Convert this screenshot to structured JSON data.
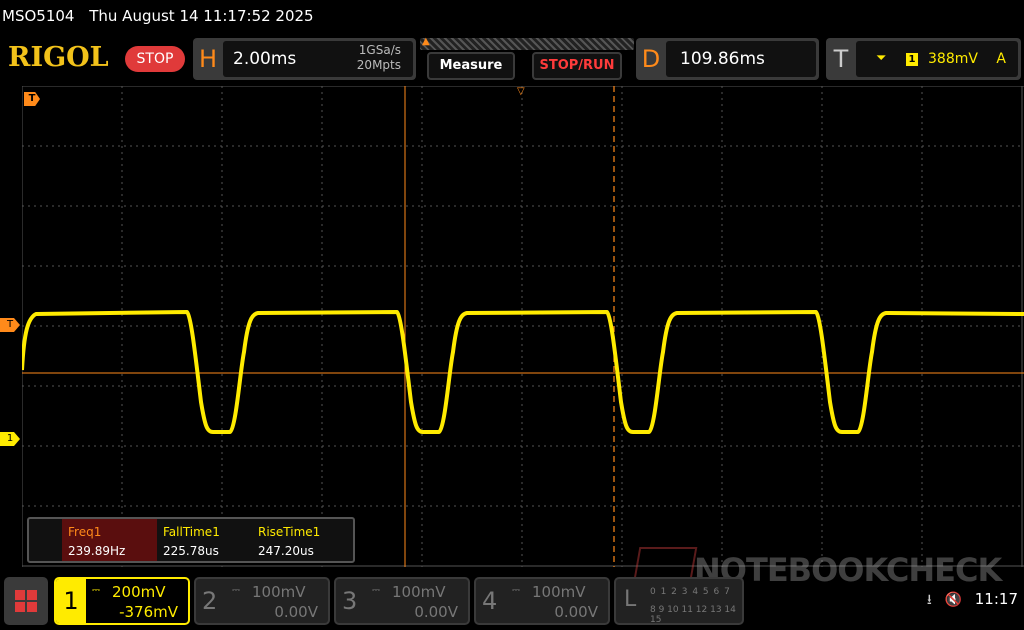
{
  "header": {
    "model": "MSO5104",
    "datetime": "Thu August 14 11:17:52 2025"
  },
  "brand": "RIGOL",
  "run_state": "STOP",
  "horizontal": {
    "label": "H",
    "timebase": "2.00ms",
    "sample_rate": "1GSa/s",
    "memory_depth": "20Mpts"
  },
  "buttons": {
    "measure": "Measure",
    "stop_run": "STOP/RUN"
  },
  "delay": {
    "label": "D",
    "value": "109.86ms"
  },
  "trigger": {
    "label": "T",
    "source": "1",
    "level": "388mV",
    "mode": "A"
  },
  "markers": {
    "trigger_top": "T",
    "trigger_level": "T",
    "channel1": "1"
  },
  "measurements": [
    {
      "label": "Freq1",
      "value": "239.89Hz"
    },
    {
      "label": "FallTime1",
      "value": "225.78us"
    },
    {
      "label": "RiseTime1",
      "value": "247.20us"
    }
  ],
  "channels": [
    {
      "number": "1",
      "scale": "200mV",
      "offset": "-376mV",
      "active": true
    },
    {
      "number": "2",
      "scale": "100mV",
      "offset": "0.00V",
      "active": false
    },
    {
      "number": "3",
      "scale": "100mV",
      "offset": "0.00V",
      "active": false
    },
    {
      "number": "4",
      "scale": "100mV",
      "offset": "0.00V",
      "active": false
    }
  ],
  "logic": {
    "label": "L",
    "digits_row1": "0 1 2 3 4 5 6 7",
    "digits_row2": "8 9 10 11 12 13 14 15"
  },
  "watermark": "NOTEBOOKCHECK",
  "status": {
    "time": "11:17"
  },
  "colors": {
    "trace": "#ffeb00",
    "cursor": "#ff8a1a",
    "accent": "#e03a3a"
  }
}
